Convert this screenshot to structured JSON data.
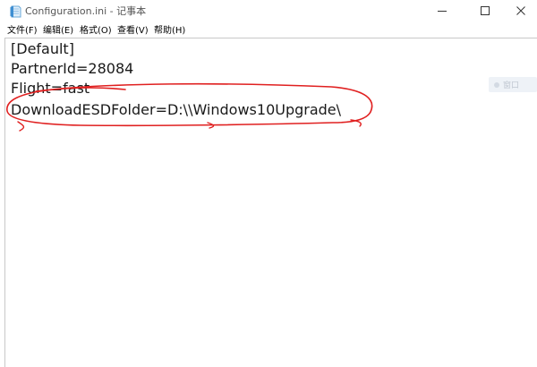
{
  "window": {
    "title": "Configuration.ini - 记事本"
  },
  "menu": {
    "file": "文件(F)",
    "edit": "编辑(E)",
    "format": "格式(O)",
    "view": "查看(V)",
    "help": "帮助(H)"
  },
  "editor": {
    "lines": [
      "[Default]",
      "PartnerId=28084",
      "Flight=fast",
      "DownloadESDFolder=D:\\\\Windows10Upgrade\\"
    ]
  },
  "side_chip": {
    "label": "窗口"
  },
  "colors": {
    "annotation_red": "#e02020",
    "border": "#c8c8c8"
  },
  "icons": {
    "app": "notepad-icon",
    "minimize": "minimize-icon",
    "maximize": "maximize-icon",
    "close": "close-icon"
  }
}
